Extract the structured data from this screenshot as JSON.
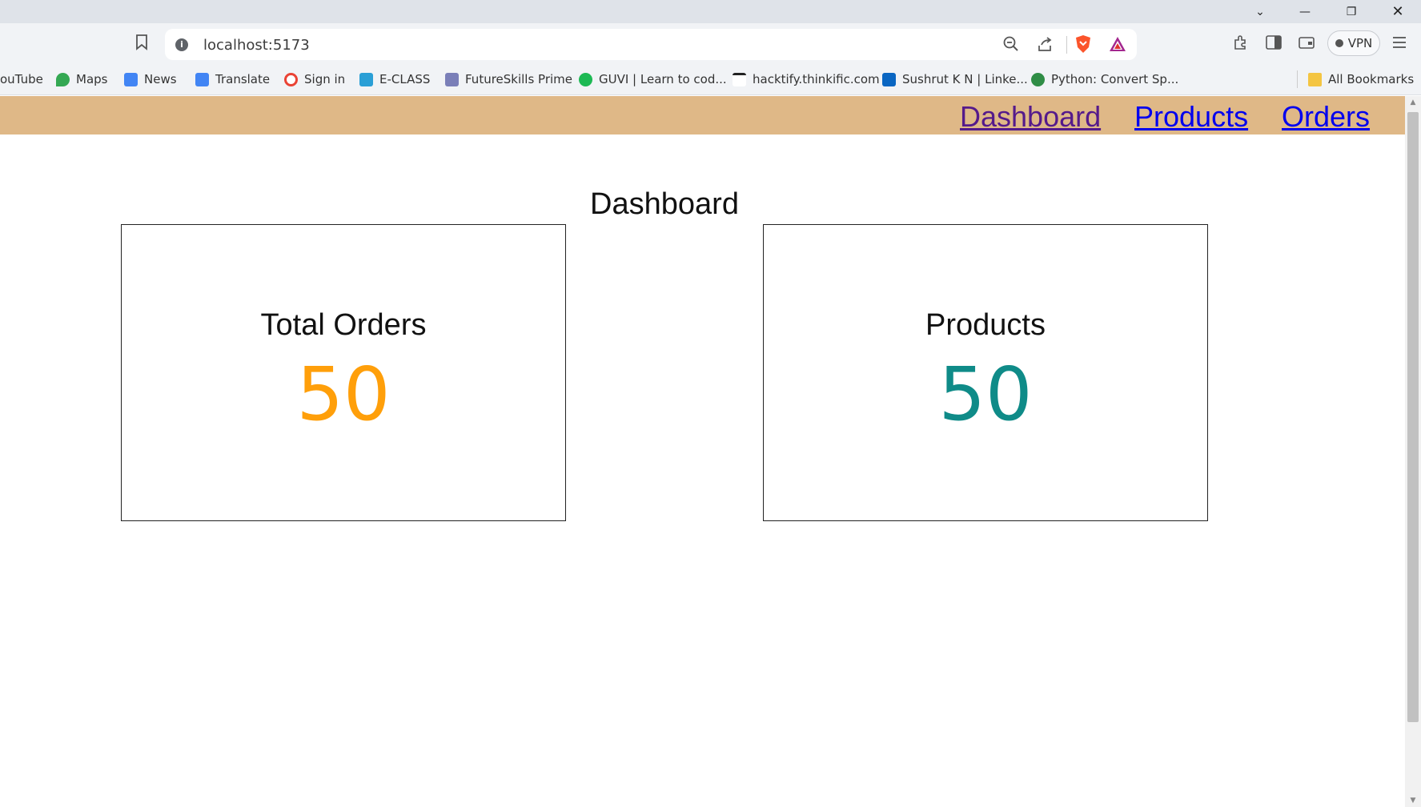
{
  "browser": {
    "url": "localhost:5173",
    "vpn_label": "VPN",
    "bookmarks": [
      {
        "label": "ouTube",
        "color": "#ff0000"
      },
      {
        "label": "Maps",
        "color": "#34a853"
      },
      {
        "label": "News",
        "color": "#4285f4"
      },
      {
        "label": "Translate",
        "color": "#4285f4"
      },
      {
        "label": "Sign in",
        "color": "#ea4335"
      },
      {
        "label": "E-CLASS",
        "color": "#2a9fd6"
      },
      {
        "label": "FutureSkills Prime",
        "color": "#7a7fb8"
      },
      {
        "label": "GUVI | Learn to cod...",
        "color": "#1db954"
      },
      {
        "label": "hacktify.thinkific.com",
        "color": "#222222"
      },
      {
        "label": "Sushrut K N | Linke...",
        "color": "#0a66c2"
      },
      {
        "label": "Python: Convert Sp...",
        "color": "#2f8d46"
      }
    ],
    "all_bookmarks_label": "All Bookmarks"
  },
  "nav": {
    "links": [
      "Dashboard",
      "Products",
      "Orders"
    ]
  },
  "page": {
    "title": "Dashboard",
    "cards": [
      {
        "label": "Total Orders",
        "value": "50",
        "color": "#ff9f0a"
      },
      {
        "label": "Products",
        "value": "50",
        "color": "#0f8b88"
      }
    ]
  }
}
